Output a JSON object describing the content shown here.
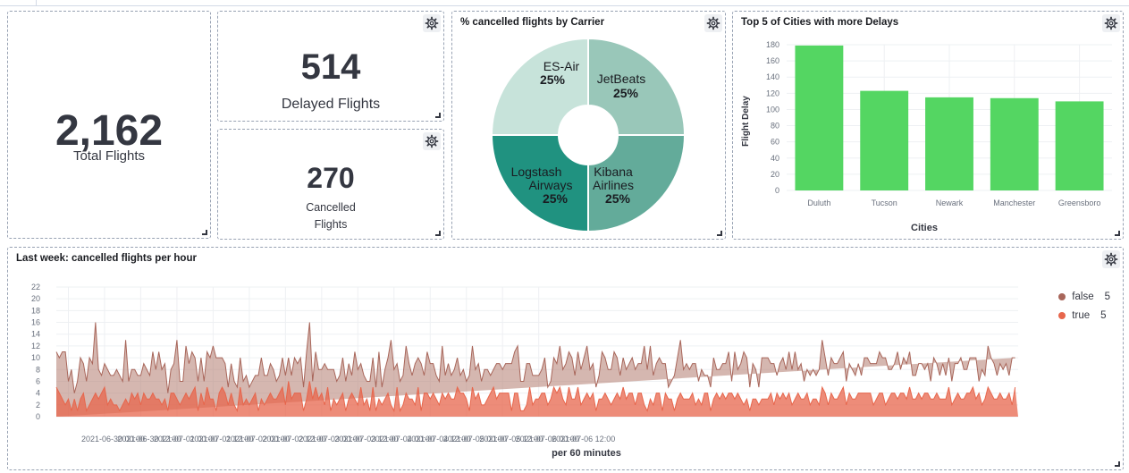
{
  "metrics": {
    "total": {
      "value": "2,162",
      "label": "Total Flights"
    },
    "delayed": {
      "value": "514",
      "label": "Delayed Flights"
    },
    "cancelled": {
      "value": "270",
      "label_line1": "Cancelled",
      "label_line2": "Flights"
    }
  },
  "colors": {
    "bar": "#54d662",
    "area_false": "#b9877b",
    "area_true": "#e7664c",
    "donut": [
      "#c7e3da",
      "#99c7b9",
      "#63ab9a",
      "#209280"
    ]
  },
  "icons": {
    "gear": "gear-icon",
    "resize": "resize-handle-icon"
  },
  "pie": {
    "title": "% cancelled flights by Carrier",
    "chart_data": {
      "type": "pie",
      "slices": [
        {
          "name": "ES-Air",
          "value": 25,
          "label": "25%"
        },
        {
          "name": "JetBeats",
          "value": 25,
          "label": "25%"
        },
        {
          "name": "Kibana Airlines",
          "value": 25,
          "label": "25%"
        },
        {
          "name": "Logstash Airways",
          "value": 25,
          "label": "25%"
        }
      ],
      "donut": true
    }
  },
  "bar": {
    "title": "Top 5 of Cities with more Delays",
    "chart_data": {
      "type": "bar",
      "categories": [
        "Duluth",
        "Tucson",
        "Newark",
        "Manchester",
        "Greensboro"
      ],
      "values": [
        179,
        123,
        115,
        114,
        110
      ],
      "xlabel": "Cities",
      "ylabel": "Flight Delay",
      "ylim": [
        0,
        180
      ],
      "yticks": [
        0,
        20,
        40,
        60,
        80,
        100,
        120,
        140,
        160,
        180
      ],
      "grid": true
    }
  },
  "area": {
    "title": "Last week: cancelled flights per hour",
    "chart_data": {
      "type": "area",
      "xlabel": "per 60 minutes",
      "xticks": [
        "2021-06-30 00:00",
        "2021-06-30 12:00",
        "2021-07-01 00:00",
        "2021-07-01 12:00",
        "2021-07-02 00:00",
        "2021-07-02 12:00",
        "2021-07-03 00:00",
        "2021-07-03 12:00",
        "2021-07-04 00:00",
        "2021-07-04 12:00",
        "2021-07-05 00:00",
        "2021-07-05 12:00",
        "2021-07-06 00:00",
        "2021-07-06 12:00"
      ],
      "yticks": [
        0,
        2,
        4,
        6,
        8,
        10,
        12,
        14,
        16,
        18,
        20,
        22
      ],
      "ylim": [
        0,
        22
      ],
      "stacked": true,
      "x_start": "2021-06-29 20:00",
      "x_step_hours": 1,
      "series": [
        {
          "name": "false",
          "legend_count": "5",
          "values": [
            6,
            6,
            8,
            9,
            3,
            7,
            1,
            5,
            7,
            5,
            5,
            8,
            6,
            12,
            5,
            3,
            4,
            6,
            4,
            5,
            6,
            6,
            4,
            10,
            4,
            4,
            5,
            3,
            5,
            5,
            5,
            4,
            7,
            5,
            8,
            6,
            6,
            3,
            4,
            5,
            10,
            4,
            3,
            8,
            6,
            7,
            5,
            5,
            6,
            4,
            6,
            7,
            9,
            9,
            6,
            5,
            5,
            3,
            5,
            4,
            4,
            5,
            4,
            4,
            3,
            3,
            3,
            6,
            7,
            5,
            4,
            5,
            5,
            3,
            3,
            5,
            5,
            4,
            4,
            6,
            5,
            6,
            4,
            8,
            10,
            3,
            6,
            5,
            4,
            7,
            3,
            7,
            5,
            4,
            4,
            6,
            5,
            6,
            3,
            8,
            6,
            4,
            5,
            3,
            5,
            5,
            4,
            8,
            3,
            5,
            6,
            11,
            7,
            4,
            5,
            5,
            8,
            6,
            4,
            7,
            5,
            8,
            3,
            7,
            6,
            5,
            4,
            4,
            8,
            4,
            5,
            4,
            5,
            5,
            3,
            4,
            3,
            6,
            7,
            5,
            5,
            4,
            6,
            5,
            3,
            3,
            6,
            5,
            4,
            5,
            5,
            8,
            7,
            8,
            5,
            5,
            7,
            4,
            5,
            4,
            4,
            4,
            6,
            3,
            3,
            5,
            5,
            7,
            5,
            7,
            6,
            7,
            4,
            6,
            6,
            7,
            8,
            5,
            5,
            4,
            4,
            8,
            6,
            5,
            6,
            8,
            6,
            4,
            5,
            5,
            5,
            6,
            6,
            5,
            5,
            10,
            7,
            9,
            5,
            5,
            6,
            8,
            5,
            2,
            3,
            6,
            7,
            9,
            5,
            6,
            5,
            5,
            7,
            3,
            6,
            3,
            3,
            4,
            7,
            4,
            5,
            5,
            6,
            7,
            2,
            8,
            4,
            6,
            9,
            7,
            4,
            6,
            5,
            3,
            7,
            7,
            7,
            5,
            7,
            3,
            6,
            6,
            5,
            7,
            6,
            8,
            4,
            6,
            3,
            4,
            5,
            5,
            4,
            6,
            8,
            6,
            5,
            6,
            6,
            6,
            6,
            6,
            4,
            5,
            5,
            4,
            5,
            3,
            6,
            6,
            5,
            7,
            6,
            7,
            6,
            8,
            5,
            4,
            5,
            8,
            4,
            6,
            6,
            6,
            4,
            4,
            5,
            6,
            4,
            5,
            3,
            7,
            5,
            4,
            6,
            4,
            5,
            4,
            6,
            5,
            7,
            5,
            4,
            6,
            5,
            7,
            2,
            6,
            4,
            7,
            6,
            6,
            4,
            5,
            5,
            6,
            3,
            8,
            5,
            7
          ]
        },
        {
          "name": "true",
          "legend_count": "5",
          "values": [
            5,
            4,
            3,
            2,
            3,
            1,
            3,
            1,
            3,
            4,
            1,
            2,
            3,
            4,
            3,
            4,
            5,
            2,
            3,
            2,
            2,
            1,
            2,
            3,
            2,
            4,
            3,
            4,
            2,
            4,
            3,
            3,
            4,
            3,
            3,
            2,
            3,
            1,
            4,
            4,
            3,
            2,
            3,
            4,
            3,
            4,
            5,
            1,
            4,
            2,
            5,
            3,
            3,
            1,
            4,
            5,
            4,
            2,
            4,
            2,
            1,
            5,
            2,
            3,
            2,
            3,
            4,
            1,
            3,
            2,
            3,
            4,
            3,
            3,
            4,
            5,
            2,
            6,
            3,
            4,
            4,
            4,
            1,
            3,
            6,
            3,
            5,
            3,
            4,
            2,
            5,
            1,
            3,
            2,
            3,
            4,
            1,
            3,
            4,
            3,
            2,
            5,
            2,
            3,
            1,
            5,
            1,
            3,
            2,
            3,
            4,
            2,
            1,
            5,
            1,
            2,
            4,
            3,
            3,
            2,
            5,
            1,
            4,
            4,
            3,
            4,
            3,
            2,
            4,
            3,
            4,
            3,
            3,
            5,
            4,
            4,
            3,
            1,
            5,
            3,
            4,
            2,
            2,
            3,
            4,
            5,
            3,
            4,
            4,
            4,
            4,
            1,
            4,
            4,
            1,
            1,
            2,
            5,
            2,
            3,
            3,
            4,
            4,
            2,
            3,
            5,
            4,
            5,
            3,
            2,
            5,
            3,
            3,
            5,
            2,
            3,
            4,
            3,
            4,
            1,
            3,
            3,
            4,
            3,
            2,
            3,
            4,
            3,
            5,
            3,
            4,
            4,
            2,
            4,
            4,
            2,
            1,
            3,
            2,
            4,
            4,
            1,
            4,
            3,
            3,
            1,
            3,
            4,
            3,
            3,
            3,
            4,
            2,
            3,
            2,
            4,
            4,
            1,
            3,
            4,
            3,
            4,
            3,
            4,
            4,
            3,
            4,
            3,
            2,
            3,
            1,
            3,
            3,
            2,
            3,
            3,
            3,
            4,
            2,
            4,
            3,
            4,
            3,
            4,
            2,
            3,
            4,
            3,
            3,
            4,
            2,
            3,
            3,
            2,
            5,
            4,
            2,
            4,
            3,
            3,
            4,
            5,
            2,
            4,
            3,
            3,
            4,
            4,
            4,
            4,
            4,
            2,
            3,
            4,
            4,
            2,
            3,
            4,
            4,
            3,
            4,
            4,
            3,
            5,
            3,
            3,
            4,
            3,
            4,
            4,
            3,
            3,
            4,
            3,
            3,
            3,
            5,
            2,
            3,
            4,
            3,
            3,
            4,
            4,
            5,
            3,
            4,
            2,
            3,
            5,
            4,
            3,
            3,
            4,
            3,
            3,
            4,
            2,
            5
          ]
        }
      ]
    }
  }
}
